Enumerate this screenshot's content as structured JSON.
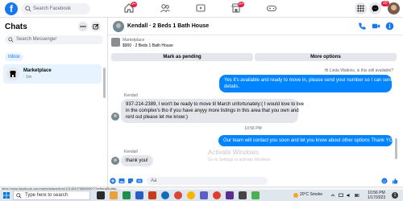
{
  "topbar": {
    "logo": "f",
    "search_placeholder": "Search Facebook",
    "nav_icons": [
      "home-icon",
      "friends-icon",
      "video-icon",
      "marketplace-icon",
      "gaming-icon"
    ],
    "nav_badges": [
      "9+",
      "9+"
    ],
    "notification_count": "20"
  },
  "sidebar": {
    "title": "Chats",
    "search_placeholder": "Search Messenger",
    "inbox_label": "Inbox",
    "conversation": {
      "name": "Marketplace",
      "time": "· 1m"
    }
  },
  "chat": {
    "header_title": "Kendall · 2 Beds 1 Bath House",
    "marketplace_card": {
      "label": "Marketplace",
      "detail": "$900 · 2 Beds 1 Bath House",
      "mark_pending_label": "Mark as pending",
      "more_options_label": "More options"
    },
    "seen_line": "Hi Linda Watkins, is this still available?",
    "messages": [
      {
        "from": "me",
        "lines": [
          "Yes it's available and ready to move in, please send your number so I can send you",
          "details."
        ]
      },
      {
        "from": "Kendall",
        "lines": [
          "937-214-2389, I won't be ready to move til March unfortunately:( I would love to live",
          "in the complex's tho if you have anyyy more listings in this area that you own and",
          "rent out please let me know:)"
        ]
      },
      {
        "from": "timestamp",
        "text": "10:56 PM"
      },
      {
        "from": "me",
        "text": "Our team will contact you soon and let you know about other options     Thank YOU"
      },
      {
        "from": "Kendall",
        "text": "thank you!"
      }
    ],
    "compose_placeholder": "Aa"
  },
  "watermark": {
    "title": "Activate Windows",
    "subtitle": "Go to Settings to activate Windows."
  },
  "statusbar": {
    "url": "https://www.facebook.com/marketplace/item/1314549758859997/?referralSurfac..."
  },
  "taskbar": {
    "search_placeholder": "Type here to search",
    "weather": "20°C  Smoke",
    "time": "10:56 PM",
    "date": "1/17/2023",
    "notification_count": "1",
    "colors": {
      "accent": "#1877f2",
      "bubble": "#0084ff"
    }
  }
}
